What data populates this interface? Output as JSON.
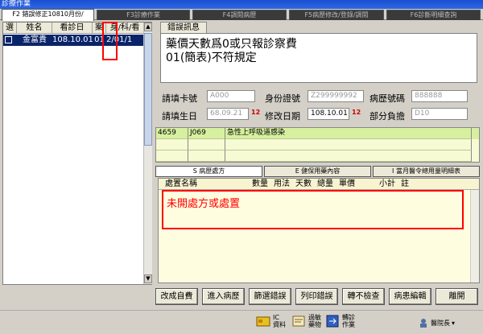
{
  "window": {
    "title": "診療作業"
  },
  "tabs": [
    {
      "label": "F2 錯誤修正10810月份/"
    },
    {
      "label": "F3診療作業"
    },
    {
      "label": "F4調閱病歷"
    },
    {
      "label": "F5病歷修改/登錄/調閱"
    },
    {
      "label": "F6診斷明細查詢"
    }
  ],
  "patient_list": {
    "headers": [
      "選",
      "姓名",
      "看診日",
      "案",
      "身/科/看"
    ],
    "rows": [
      {
        "name": "金富貴",
        "date": "108.10.01",
        "case": "01",
        "tail": "2/01/1"
      }
    ]
  },
  "error_section": {
    "tab_label": "錯誤訊息",
    "lines": [
      "藥價天數爲0或只報診察費",
      "01(簡表)不符規定"
    ]
  },
  "form": {
    "card_no_label": "請填卡號",
    "card_no_value": "A000",
    "id_label": "身份證號",
    "id_value": "Z299999992",
    "chart_no_label": "病歷號碼",
    "chart_no_value": "888888",
    "birth_label": "請填生日",
    "birth_value": "68.09.21",
    "modify_date_label": "修改日期",
    "modify_date_value": "108.10.01",
    "copay_label": "部分負擔",
    "copay_value": "D10",
    "cal_symbol": "12"
  },
  "diagnosis": {
    "rows": [
      {
        "code1": "4659",
        "code2": "J069",
        "desc": "急性上呼吸道感染"
      }
    ]
  },
  "sub_tabs": [
    {
      "label": "S 病歷處方"
    },
    {
      "label": "E 健保用藥內容"
    },
    {
      "label": "I 當月醫令總用量明細表"
    }
  ],
  "rx_panel": {
    "headers": [
      "處置名稱",
      "數量",
      "用法",
      "天數",
      "總量",
      "單價",
      "小計",
      "註"
    ],
    "message": "未開處方或處置"
  },
  "buttons": [
    {
      "label": "改成自費"
    },
    {
      "label": "進入病歷"
    },
    {
      "label": "篩選錯誤"
    },
    {
      "label": "列印錯誤"
    },
    {
      "label": "轉不檢查"
    },
    {
      "label": "病患編輯"
    },
    {
      "label": "離開"
    }
  ],
  "bottom_bar": {
    "ic_label1": "IC",
    "ic_label2": "資料",
    "sync_label1": "過敏",
    "sync_label2": "藥物",
    "switch_label1": "轉診",
    "switch_label2": "作業",
    "staff_label": "醫院長"
  },
  "colors": {
    "selection": "#0a246a",
    "error_red": "#ff0000",
    "diag_bg": "#f7fbd4",
    "rx_bg": "#fffde0"
  }
}
